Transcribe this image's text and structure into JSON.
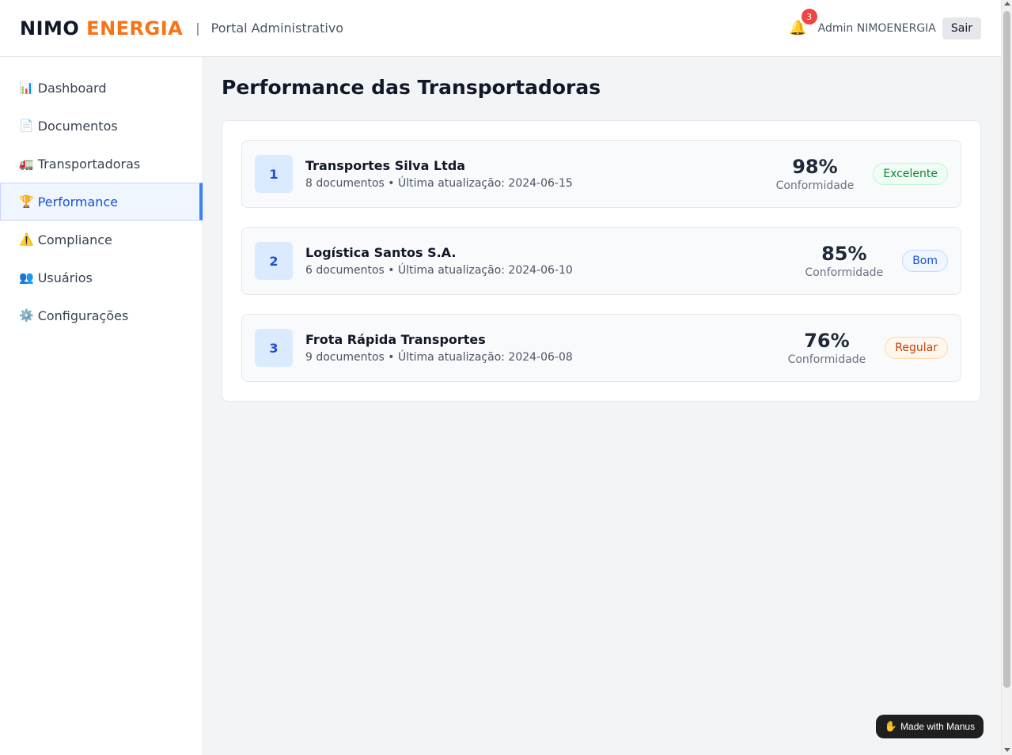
{
  "header": {
    "logo_part1": "NIMO",
    "logo_part2": "ENERGIA",
    "separator": "|",
    "portal_title": "Portal Administrativo",
    "notification_count": "3",
    "user_name": "Admin NIMOENERGIA",
    "logout_label": "Sair"
  },
  "sidebar": {
    "items": [
      {
        "icon": "📊",
        "label": "Dashboard"
      },
      {
        "icon": "📄",
        "label": "Documentos"
      },
      {
        "icon": "🚛",
        "label": "Transportadoras"
      },
      {
        "icon": "🏆",
        "label": "Performance"
      },
      {
        "icon": "⚠️",
        "label": "Compliance"
      },
      {
        "icon": "👥",
        "label": "Usuários"
      },
      {
        "icon": "⚙️",
        "label": "Configurações"
      }
    ]
  },
  "main": {
    "page_title": "Performance das Transportadoras",
    "carriers": [
      {
        "rank": "1",
        "name": "Transportes Silva Ltda",
        "meta": "8 documentos • Última atualização: 2024-06-15",
        "percent": "98%",
        "percent_label": "Conformidade",
        "status": "Excelente"
      },
      {
        "rank": "2",
        "name": "Logística Santos S.A.",
        "meta": "6 documentos • Última atualização: 2024-06-10",
        "percent": "85%",
        "percent_label": "Conformidade",
        "status": "Bom"
      },
      {
        "rank": "3",
        "name": "Frota Rápida Transportes",
        "meta": "9 documentos • Última atualização: 2024-06-08",
        "percent": "76%",
        "percent_label": "Conformidade",
        "status": "Regular"
      }
    ]
  },
  "footer_badge": {
    "label": "Made with Manus"
  },
  "colors": {
    "brand_orange": "#f97316",
    "accent_blue": "#3b82f6",
    "status_excellent": "#15803d",
    "status_good": "#1d4ed8",
    "status_regular": "#c2410c"
  }
}
